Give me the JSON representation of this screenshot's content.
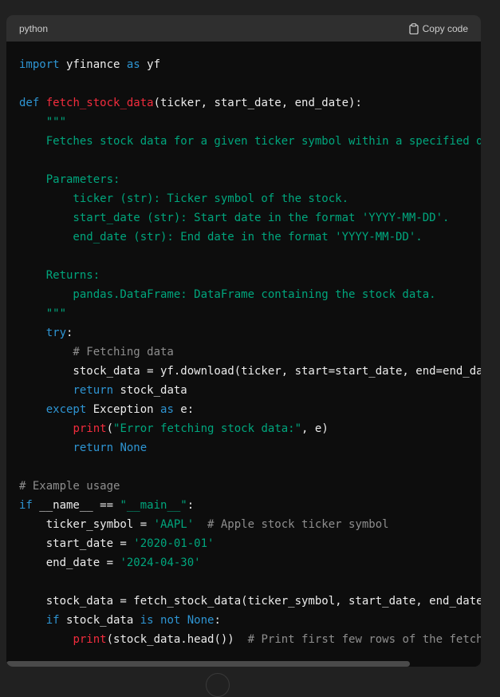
{
  "header": {
    "language": "python",
    "copy_label": "Copy code"
  },
  "colors": {
    "keyword": "#2e95d3",
    "function": "#f22c3d",
    "string": "#00a67d",
    "comment": "#8e8e8e",
    "plain": "#ececec"
  },
  "code_lines": [
    [
      [
        "k",
        "import"
      ],
      [
        "p",
        " yfinance "
      ],
      [
        "k",
        "as"
      ],
      [
        "p",
        " yf"
      ]
    ],
    [],
    [
      [
        "k",
        "def"
      ],
      [
        "p",
        " "
      ],
      [
        "f",
        "fetch_stock_data"
      ],
      [
        "p",
        "(ticker, start_date, end_date):"
      ]
    ],
    [
      [
        "s",
        "    \"\"\""
      ]
    ],
    [
      [
        "s",
        "    Fetches stock data for a given ticker symbol within a specified date range."
      ]
    ],
    [],
    [
      [
        "s",
        "    Parameters:"
      ]
    ],
    [
      [
        "s",
        "        ticker (str): Ticker symbol of the stock."
      ]
    ],
    [
      [
        "s",
        "        start_date (str): Start date in the format 'YYYY-MM-DD'."
      ]
    ],
    [
      [
        "s",
        "        end_date (str): End date in the format 'YYYY-MM-DD'."
      ]
    ],
    [],
    [
      [
        "s",
        "    Returns:"
      ]
    ],
    [
      [
        "s",
        "        pandas.DataFrame: DataFrame containing the stock data."
      ]
    ],
    [
      [
        "s",
        "    \"\"\""
      ]
    ],
    [
      [
        "p",
        "    "
      ],
      [
        "k",
        "try"
      ],
      [
        "p",
        ":"
      ]
    ],
    [
      [
        "c",
        "        # Fetching data"
      ]
    ],
    [
      [
        "p",
        "        stock_data = yf.download(ticker, start=start_date, end=end_date)"
      ]
    ],
    [
      [
        "p",
        "        "
      ],
      [
        "k",
        "return"
      ],
      [
        "p",
        " stock_data"
      ]
    ],
    [
      [
        "p",
        "    "
      ],
      [
        "k",
        "except"
      ],
      [
        "p",
        " Exception "
      ],
      [
        "k",
        "as"
      ],
      [
        "p",
        " e:"
      ]
    ],
    [
      [
        "p",
        "        "
      ],
      [
        "f",
        "print"
      ],
      [
        "p",
        "("
      ],
      [
        "s",
        "\"Error fetching stock data:\""
      ],
      [
        "p",
        ", e)"
      ]
    ],
    [
      [
        "p",
        "        "
      ],
      [
        "k",
        "return"
      ],
      [
        "p",
        " "
      ],
      [
        "k",
        "None"
      ]
    ],
    [],
    [
      [
        "c",
        "# Example usage"
      ]
    ],
    [
      [
        "k",
        "if"
      ],
      [
        "p",
        " __name__ == "
      ],
      [
        "s",
        "\"__main__\""
      ],
      [
        "p",
        ":"
      ]
    ],
    [
      [
        "p",
        "    ticker_symbol = "
      ],
      [
        "s",
        "'AAPL'"
      ],
      [
        "p",
        "  "
      ],
      [
        "c",
        "# Apple stock ticker symbol"
      ]
    ],
    [
      [
        "p",
        "    start_date = "
      ],
      [
        "s",
        "'2020-01-01'"
      ]
    ],
    [
      [
        "p",
        "    end_date = "
      ],
      [
        "s",
        "'2024-04-30'"
      ]
    ],
    [],
    [
      [
        "p",
        "    stock_data = fetch_stock_data(ticker_symbol, start_date, end_date)"
      ]
    ],
    [
      [
        "p",
        "    "
      ],
      [
        "k",
        "if"
      ],
      [
        "p",
        " stock_data "
      ],
      [
        "k",
        "is not None"
      ],
      [
        "p",
        ":"
      ]
    ],
    [
      [
        "p",
        "        "
      ],
      [
        "f",
        "print"
      ],
      [
        "p",
        "(stock_data.head())  "
      ],
      [
        "c",
        "# Print first few rows of the fetched data"
      ]
    ]
  ]
}
